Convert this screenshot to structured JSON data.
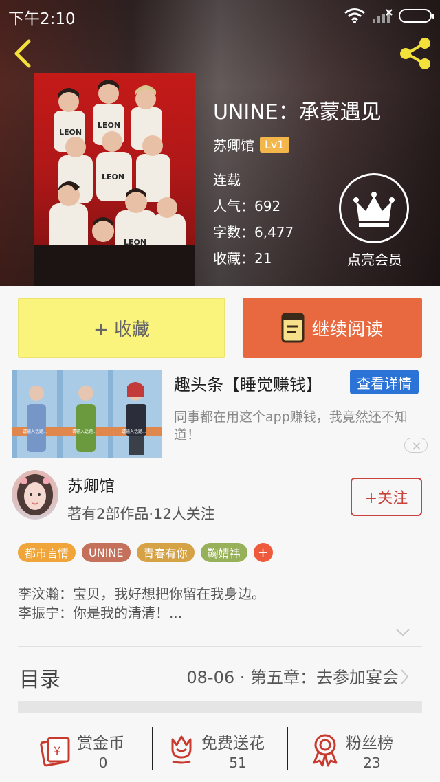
{
  "status": {
    "time": "下午2:10"
  },
  "book": {
    "title": "UNINE：承蒙遇见",
    "author": "苏卿馆",
    "level": "Lv1",
    "status": "连载",
    "popularity": "人气：692",
    "word_count": "字数：6,477",
    "favorites": "收藏：21",
    "vip_label": "点亮会员"
  },
  "actions": {
    "collect": "+ 收藏",
    "read": "继续阅读"
  },
  "ad": {
    "title": "趣头条【睡觉赚钱】",
    "detail_button": "查看详情",
    "description": "同事都在用这个app赚钱，我竟然还不知道！"
  },
  "author_block": {
    "name": "苏卿馆",
    "meta": "著有2部作品·12人关注",
    "follow": "+关注"
  },
  "tags": [
    {
      "label": "都市言情",
      "color": "#f0a53a"
    },
    {
      "label": "UNINE",
      "color": "#c5705a"
    },
    {
      "label": "青春有你",
      "color": "#d5a245"
    },
    {
      "label": "鞠婧祎",
      "color": "#97b05a"
    }
  ],
  "tag_add": "+",
  "intro": {
    "line1": "李汶瀚：宝贝，我好想把你留在我身边。",
    "line2": "李振宁：你是我的清清！..."
  },
  "toc": {
    "label": "目录",
    "latest": "08-06 · 第五章：去参加宴会"
  },
  "bottom": [
    {
      "label": "赏金币",
      "count": "0"
    },
    {
      "label": "免费送花",
      "count": "51"
    },
    {
      "label": "粉丝榜",
      "count": "23"
    }
  ],
  "colors": {
    "accent_orange": "#e8683f",
    "accent_yellow": "#fbf47c",
    "follow_red": "#c9423c",
    "ad_blue": "#2b73d6"
  }
}
